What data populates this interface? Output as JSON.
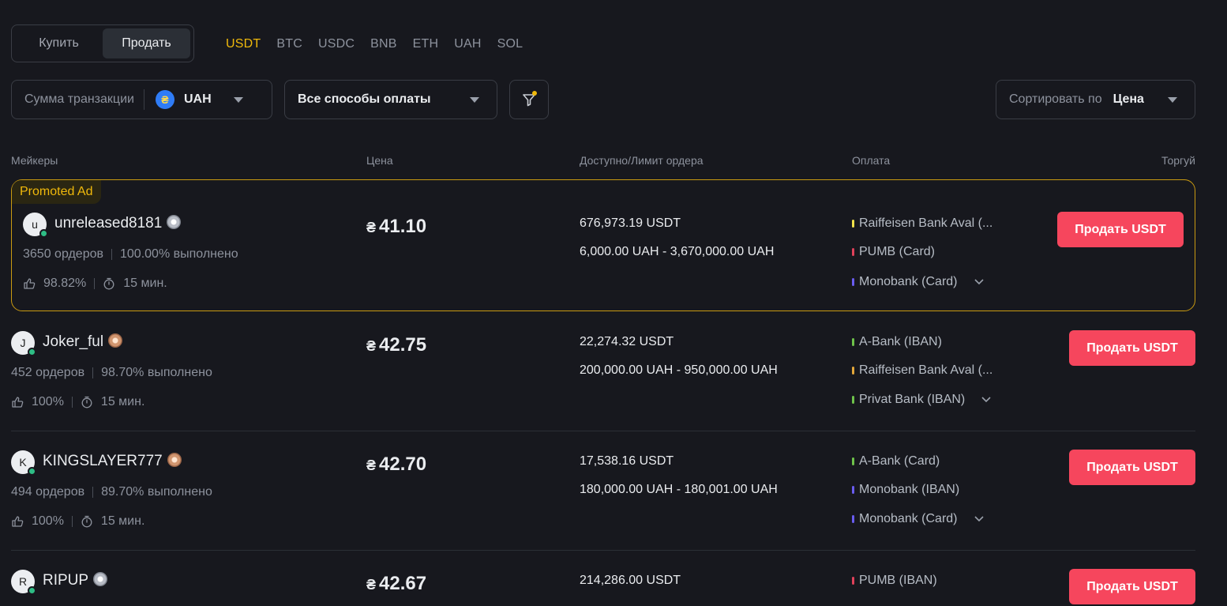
{
  "toggle": {
    "buy": "Купить",
    "sell": "Продать"
  },
  "coins": [
    "USDT",
    "BTC",
    "USDC",
    "BNB",
    "ETH",
    "UAH",
    "SOL"
  ],
  "filters": {
    "amount_label": "Сумма транзакции",
    "currency": "UAH",
    "currency_icon": "₴",
    "payment": "Все способы оплаты",
    "sort_label": "Сортировать по",
    "sort_value": "Цена"
  },
  "columns": {
    "makers": "Мейкеры",
    "price": "Цена",
    "available": "Доступно/Лимит ордера",
    "payment": "Оплата",
    "trade": "Торгуй"
  },
  "colors": {
    "accent": "#f0b90b",
    "sell": "#f6465d",
    "online": "#2ebd85",
    "pay_yellow": "#f0e14a",
    "pay_red": "#e0415a",
    "pay_purple": "#6a5cf0",
    "pay_green": "#6ec24a",
    "pay_orange": "#e3a73a"
  },
  "promoted_tag": "Promoted Ad",
  "ads": [
    {
      "avatar": "u",
      "name": "unreleased8181",
      "badge": "silver-badge-icon",
      "orders": "3650 ордеров",
      "completion": "100.00% выполнено",
      "rating": "98.82%",
      "time": "15 мин.",
      "currency_symbol": "₴",
      "price": "41.10",
      "available": "676,973.19 USDT",
      "limit": "6,000.00 UAH - 3,670,000.00 UAH",
      "payments": [
        "Raiffeisen Bank Aval (...",
        "PUMB (Card)",
        "Monobank (Card)"
      ],
      "button": "Продать USDT"
    },
    {
      "avatar": "J",
      "name": "Joker_ful",
      "badge": "bronze-badge-icon",
      "orders": "452 ордеров",
      "completion": "98.70% выполнено",
      "rating": "100%",
      "time": "15 мин.",
      "currency_symbol": "₴",
      "price": "42.75",
      "available": "22,274.32 USDT",
      "limit": "200,000.00 UAH - 950,000.00 UAH",
      "payments": [
        "A-Bank (IBAN)",
        "Raiffeisen Bank Aval (...",
        "Privat Bank (IBAN)"
      ],
      "button": "Продать USDT"
    },
    {
      "avatar": "K",
      "name": "KINGSLAYER777",
      "badge": "bronze-badge-icon",
      "orders": "494 ордеров",
      "completion": "89.70% выполнено",
      "rating": "100%",
      "time": "15 мин.",
      "currency_symbol": "₴",
      "price": "42.70",
      "available": "17,538.16 USDT",
      "limit": "180,000.00 UAH - 180,001.00 UAH",
      "payments": [
        "A-Bank (Card)",
        "Monobank (IBAN)",
        "Monobank (Card)"
      ],
      "button": "Продать USDT"
    },
    {
      "avatar": "R",
      "name": "RIPUP",
      "badge": "silver-badge-icon",
      "currency_symbol": "₴",
      "price": "42.67",
      "available": "214,286.00 USDT",
      "payments": [
        "PUMB (IBAN)"
      ],
      "button": "Продать USDT"
    }
  ]
}
